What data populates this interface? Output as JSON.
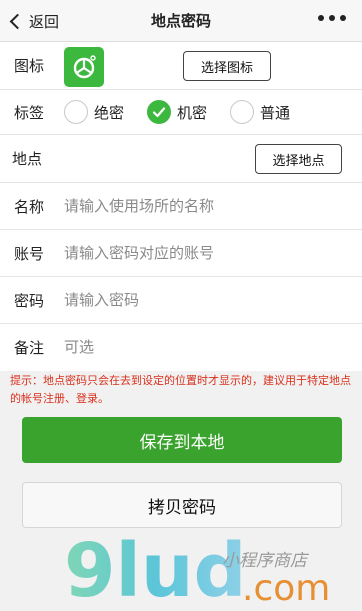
{
  "navbar": {
    "back_label": "返回",
    "title": "地点密码"
  },
  "icon_row": {
    "label": "图标",
    "button_label": "选择图标",
    "icon_color": "#3db83f"
  },
  "tag_row": {
    "label": "标签",
    "options": [
      {
        "label": "绝密",
        "checked": false
      },
      {
        "label": "机密",
        "checked": true
      },
      {
        "label": "普通",
        "checked": false
      }
    ]
  },
  "location_row": {
    "label": "地点",
    "button_label": "选择地点"
  },
  "fields": {
    "name": {
      "label": "名称",
      "placeholder": "请输入使用场所的名称",
      "value": ""
    },
    "account": {
      "label": "账号",
      "placeholder": "请输入密码对应的账号",
      "value": ""
    },
    "password": {
      "label": "密码",
      "placeholder": "请输入密码",
      "value": ""
    },
    "note": {
      "label": "备注",
      "placeholder": "可选",
      "value": ""
    }
  },
  "hint": "提示：地点密码只会在去到设定的位置时才显示的，建议用于特定地点的帐号注册、登录。",
  "actions": {
    "save_label": "保存到本地",
    "copy_label": "拷贝密码"
  },
  "watermark": {
    "logo_text": "9lud",
    "tagline": "小程序商店",
    "domain": ".com"
  },
  "colors": {
    "accent": "#3aa32d",
    "hint": "#d9301c"
  }
}
